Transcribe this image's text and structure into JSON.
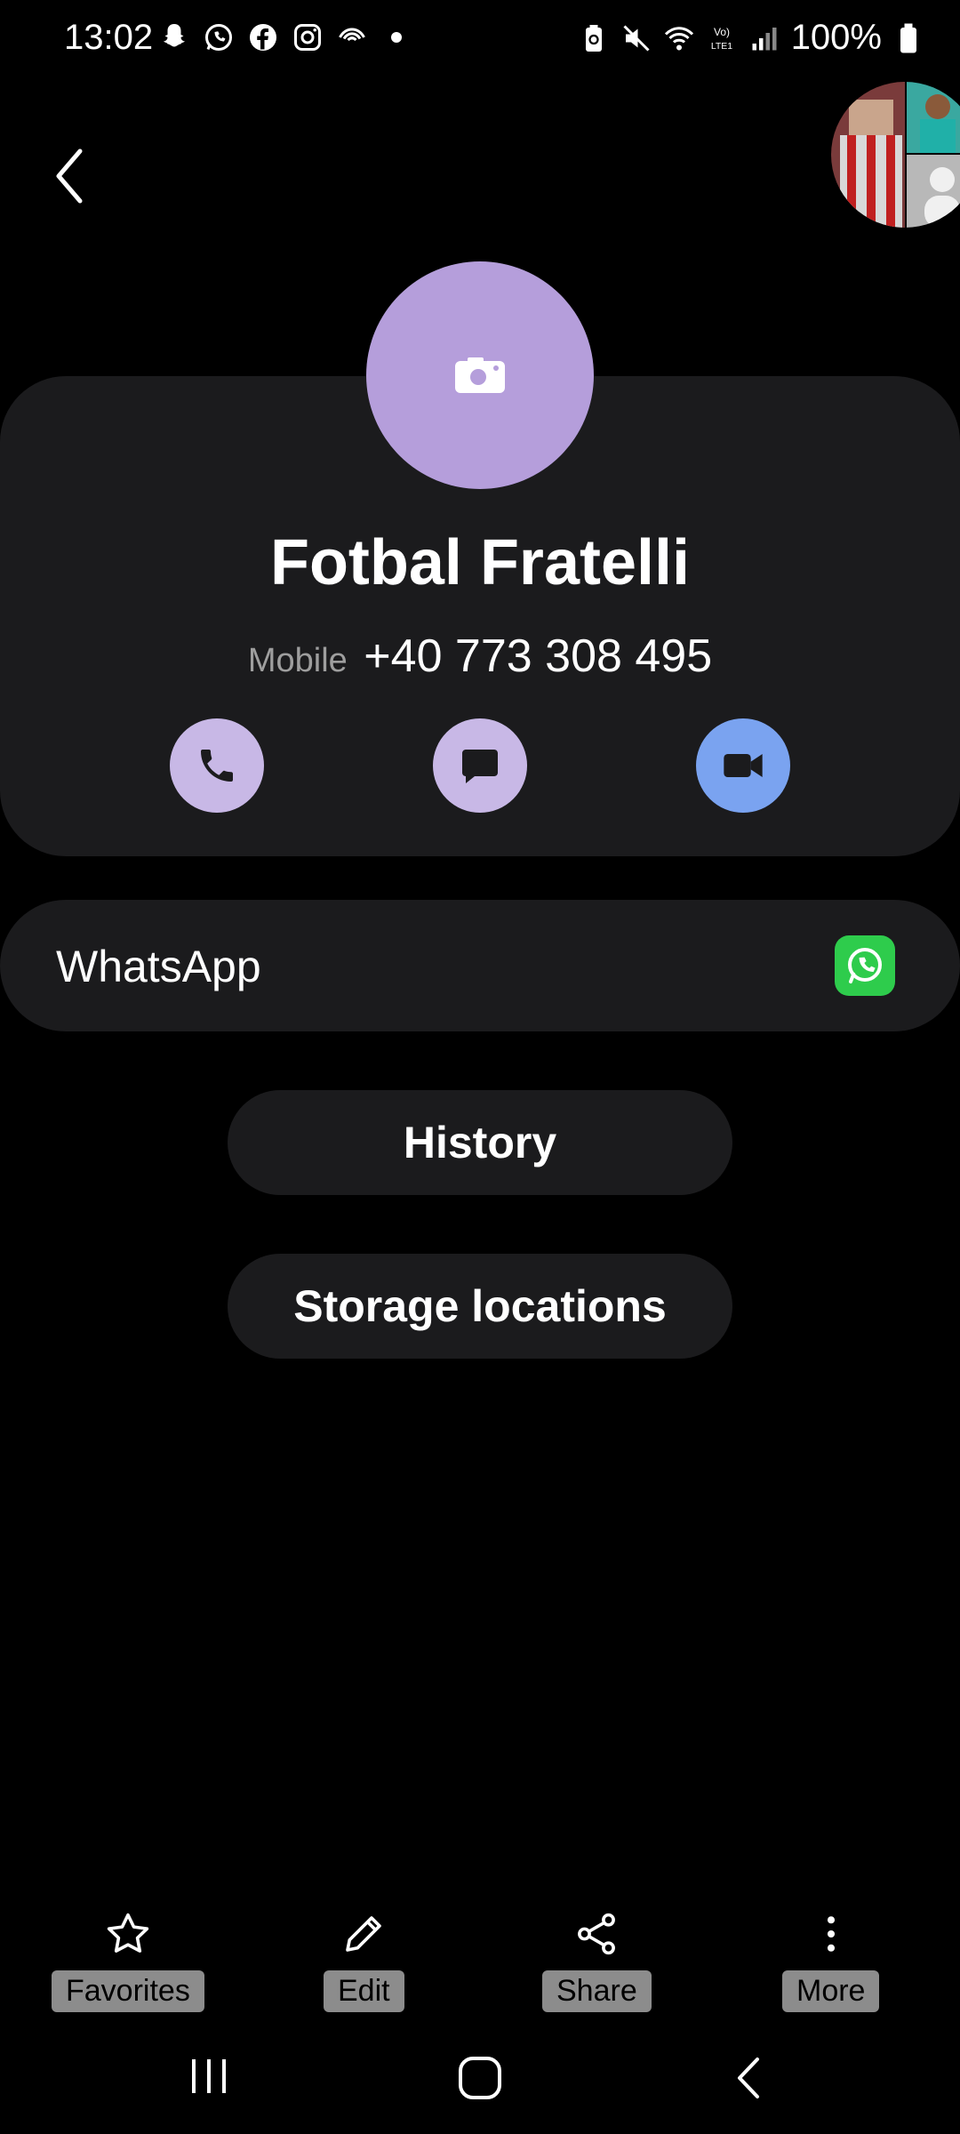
{
  "status_bar": {
    "time": "13:02",
    "battery": "100%",
    "left_icons": [
      "snapchat-icon",
      "whatsapp-icon",
      "facebook-icon",
      "instagram-icon",
      "fan-icon",
      "dot-icon"
    ],
    "right_icons": [
      "battery-saver-icon",
      "mute-icon",
      "wifi-icon",
      "volte-icon",
      "signal-icon",
      "battery-icon"
    ]
  },
  "contact": {
    "name": "Fotbal Fratelli",
    "phone_label": "Mobile",
    "phone_number": "+40 773 308 495"
  },
  "actions": [
    "call",
    "message",
    "video-call"
  ],
  "linked_app": {
    "label": "WhatsApp"
  },
  "buttons": {
    "history": "History",
    "storage": "Storage locations"
  },
  "bottom_bar": {
    "favorites": "Favorites",
    "edit": "Edit",
    "share": "Share",
    "more": "More"
  },
  "colors": {
    "background": "#000000",
    "card": "#1b1b1d",
    "avatar": "#b59edb",
    "action_purple": "#c8b8e6",
    "action_blue": "#7aa3f0",
    "whatsapp_green": "#2ecc4c"
  }
}
